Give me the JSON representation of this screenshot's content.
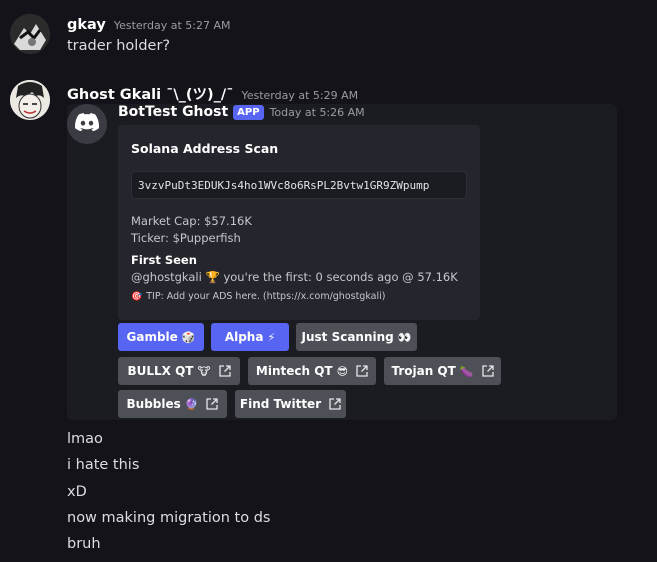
{
  "messages": [
    {
      "username": "gkay",
      "timestamp": "Yesterday at 5:27 AM",
      "text": "trader holder?"
    },
    {
      "username": "Ghost Gkali ¯\\_(ツ)_/¯",
      "timestamp": "Yesterday at 5:29 AM"
    }
  ],
  "bot": {
    "name": "BotTest Ghost",
    "badge": "APP",
    "timestamp": "Today at 5:26 AM",
    "embed": {
      "title": "Solana Address Scan",
      "address": "3vzvPuDt3EDUKJs4ho1WVc8o6RsPL2Bvtw1GR9ZWpump",
      "market_cap": "Market Cap: $57.16K",
      "ticker": "Ticker: $Pupperfish",
      "field_name": "First Seen",
      "field_value_user": "@ghostgkali",
      "field_value_trophy": "🏆",
      "field_value_rest": "you're the first: 0 seconds ago @ 57.16K",
      "tip_icon": "🎯",
      "tip": "TIP: Add your ADS here. (https://x.com/ghostgkali)"
    },
    "buttons_row1": [
      {
        "label": "Gamble",
        "emoji": "🎲",
        "style": "primary"
      },
      {
        "label": "Alpha",
        "emoji": "⚡",
        "style": "primary"
      },
      {
        "label": "Just Scanning",
        "emoji": "👀",
        "style": "secondary"
      }
    ],
    "buttons_row2": [
      {
        "label": "BULLX QT",
        "emoji": "🐮"
      },
      {
        "label": "Mintech QT",
        "emoji": "😎"
      },
      {
        "label": "Trojan QT",
        "emoji": "🍆"
      }
    ],
    "buttons_row3": [
      {
        "label": "Bubbles",
        "emoji": "🔮"
      },
      {
        "label": "Find Twitter"
      }
    ]
  },
  "followups": [
    "lmao",
    "i hate this",
    "xD",
    "now making migration to ds",
    "bruh"
  ],
  "colors": {
    "background": "#131319",
    "blurple": "#5865f2",
    "secondary_button": "#4e5058",
    "embed_bg": "#25252d"
  }
}
